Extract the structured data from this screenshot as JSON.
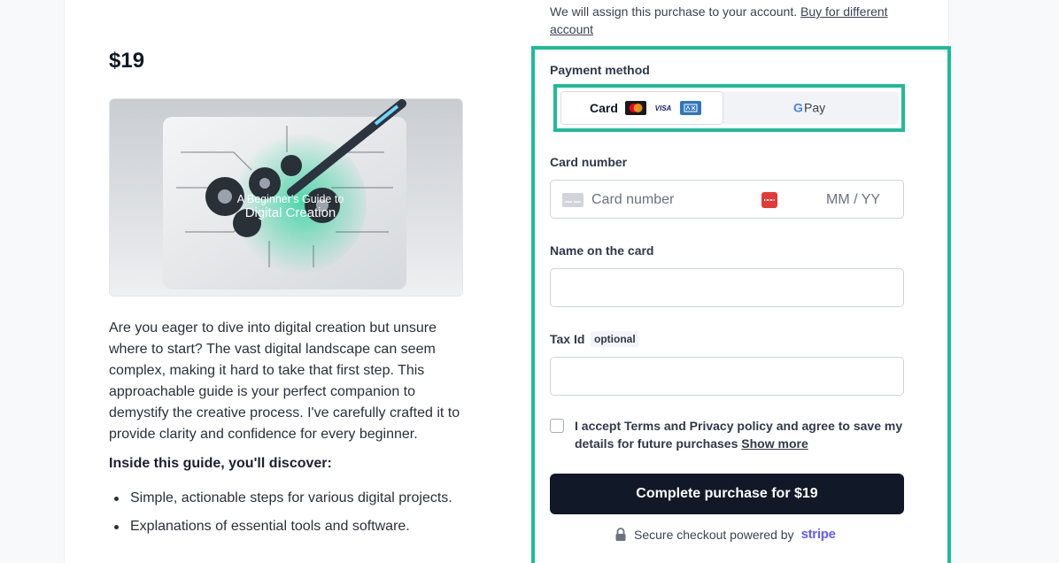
{
  "product": {
    "title": "Creation",
    "price": "$19",
    "image_caption_line1": "A Beginner's Guide to",
    "image_caption_line2": "Digital Creation",
    "description": "Are you eager to dive into digital creation but unsure where to start? The vast digital landscape can seem complex, making it hard to take that first step. This approachable guide is your perfect companion to demystify the creative process. I've carefully crafted it to provide clarity and confidence for every beginner.",
    "inside_heading": "Inside this guide, you'll discover:",
    "bullets": [
      "Simple, actionable steps for various digital projects.",
      "Explanations of essential tools and software."
    ]
  },
  "checkout": {
    "account_note": "We will assign this purchase to your account.",
    "account_link": "Buy for different account",
    "payment_method_label": "Payment method",
    "tabs": {
      "card": "Card",
      "gpay": "G Pay"
    },
    "card_number_label": "Card number",
    "card_number_placeholder": "Card number",
    "expiry_placeholder": "MM / YY",
    "name_label": "Name on the card",
    "name_value": "",
    "tax_label": "Tax Id",
    "tax_optional": "optional",
    "tax_value": "",
    "consent_text": "I accept Terms and Privacy policy and agree to save my details for future purchases",
    "consent_link": "Show more",
    "pay_button": "Complete purchase for $19",
    "secure_text": "Secure checkout powered by",
    "secure_brand": "stripe"
  },
  "colors": {
    "highlight": "#1ebc99",
    "button": "#111827",
    "stripe": "#635bff"
  }
}
